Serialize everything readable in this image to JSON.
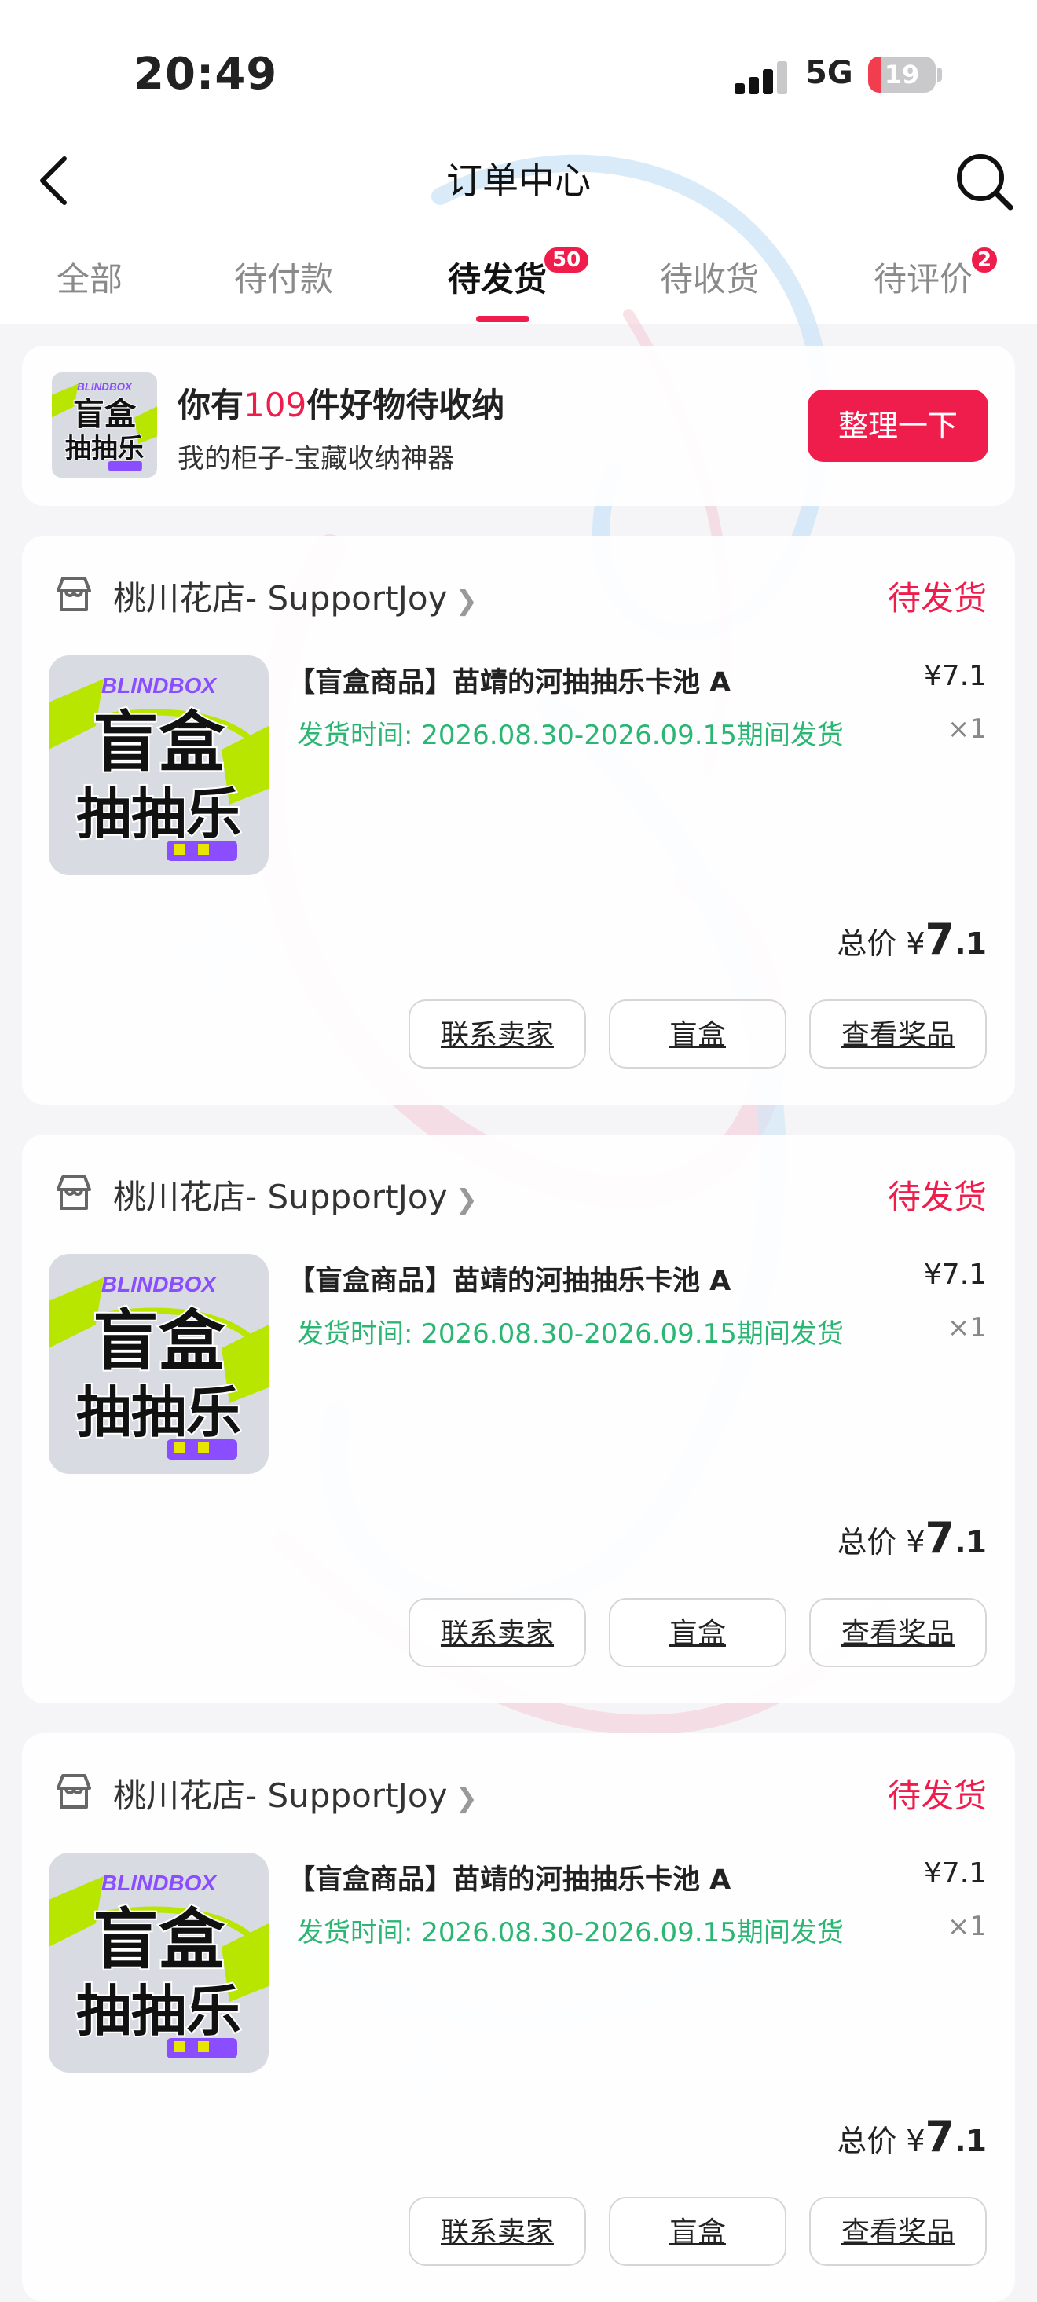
{
  "status_bar": {
    "time": "20:49",
    "network": "5G",
    "battery": "19",
    "battery_level_percent": 19
  },
  "header": {
    "title": "订单中心",
    "back_icon": "chevron-left-icon",
    "search_icon": "search-icon"
  },
  "tabs": [
    {
      "label": "全部",
      "active": false
    },
    {
      "label": "待付款",
      "active": false
    },
    {
      "label": "待发货",
      "active": true,
      "badge": "50"
    },
    {
      "label": "待收货",
      "active": false
    },
    {
      "label": "待评价",
      "active": false,
      "badge": "2"
    }
  ],
  "promo": {
    "title_prefix": "你有",
    "count": "109",
    "title_suffix": "件好物待收纳",
    "subtitle": "我的柜子-宝藏收纳神器",
    "button": "整理一下"
  },
  "product_image": {
    "brand": "BLINDBOX",
    "line1": "盲盒",
    "line2": "抽抽乐"
  },
  "orders": [
    {
      "store": "桃川花店- SupportJoy",
      "status": "待发货",
      "product_name": "【盲盒商品】苗靖的河抽抽乐卡池 A",
      "price": "¥7.1",
      "ship_time": "发货时间: 2026.08.30-2026.09.15期间发货",
      "qty": "×1",
      "total_label": "总价",
      "total_currency": "¥",
      "total_int": "7",
      "total_dec": ".1",
      "buttons": [
        "联系卖家",
        "盲盒",
        "查看奖品"
      ]
    },
    {
      "store": "桃川花店- SupportJoy",
      "status": "待发货",
      "product_name": "【盲盒商品】苗靖的河抽抽乐卡池 A",
      "price": "¥7.1",
      "ship_time": "发货时间: 2026.08.30-2026.09.15期间发货",
      "qty": "×1",
      "total_label": "总价",
      "total_currency": "¥",
      "total_int": "7",
      "total_dec": ".1",
      "buttons": [
        "联系卖家",
        "盲盒",
        "查看奖品"
      ]
    },
    {
      "store": "桃川花店- SupportJoy",
      "status": "待发货",
      "product_name": "【盲盒商品】苗靖的河抽抽乐卡池 A",
      "price": "¥7.1",
      "ship_time": "发货时间: 2026.08.30-2026.09.15期间发货",
      "qty": "×1",
      "total_label": "总价",
      "total_currency": "¥",
      "total_int": "7",
      "total_dec": ".1",
      "buttons": [
        "联系卖家",
        "盲盒",
        "查看奖品"
      ]
    }
  ],
  "colors": {
    "accent": "#ef1d4c",
    "ship_green": "#2bb673",
    "thumb_purple": "#8a4dff",
    "thumb_lime": "#b8e600"
  }
}
